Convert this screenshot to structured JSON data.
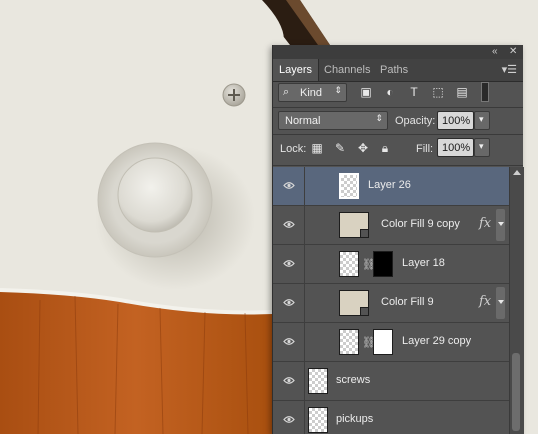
{
  "panel": {
    "top_controls": [
      "collapse-icon",
      "close-icon"
    ],
    "menu_icon": "panel-menu-icon",
    "tabs": [
      {
        "label": "Layers",
        "active": true
      },
      {
        "label": "Channels",
        "active": false
      },
      {
        "label": "Paths",
        "active": false
      }
    ],
    "filter": {
      "kind_label": "Kind",
      "kind_icon": "search-icon",
      "filter_icons": [
        "image-filter-icon",
        "adjustment-filter-icon",
        "type-filter-icon",
        "shape-filter-icon",
        "smart-object-filter-icon",
        "filter-toggle-icon"
      ]
    },
    "blend_mode": "Normal",
    "opacity": {
      "label": "Opacity:",
      "value": "100%"
    },
    "lock": {
      "label": "Lock:",
      "icons": [
        "lock-transparent-pixels-icon",
        "lock-image-pixels-icon",
        "lock-position-icon",
        "lock-all-icon"
      ]
    },
    "fill": {
      "label": "Fill:",
      "value": "100%"
    }
  },
  "layers": [
    {
      "name": "Layer 26",
      "thumb": "transparent",
      "selected": true,
      "indent": true,
      "mask": false,
      "fx": false
    },
    {
      "name": "Color Fill 9 copy",
      "thumb": "fill",
      "selected": false,
      "indent": true,
      "mask": false,
      "fx": true
    },
    {
      "name": "Layer 18",
      "thumb": "transparent",
      "selected": false,
      "indent": true,
      "mask": "black",
      "fx": false
    },
    {
      "name": "Color Fill 9",
      "thumb": "fill",
      "selected": false,
      "indent": true,
      "mask": false,
      "fx": true
    },
    {
      "name": "Layer 29 copy",
      "thumb": "transparent",
      "selected": false,
      "indent": true,
      "mask": "white",
      "fx": false
    },
    {
      "name": "screws",
      "thumb": "transparent",
      "selected": false,
      "indent": false,
      "mask": false,
      "fx": false
    },
    {
      "name": "pickups",
      "thumb": "transparent",
      "selected": false,
      "indent": false,
      "mask": false,
      "fx": false
    }
  ],
  "layer_badges": {
    "fx_label": "fx",
    "link_icon": "link-chain-icon",
    "visibility_icon": "eye-icon"
  },
  "colors": {
    "panel_bg": "#535353",
    "selected_row": "#59677d",
    "canvas_pickguard": "#e9e7df",
    "canvas_wood": "#b4561a"
  }
}
